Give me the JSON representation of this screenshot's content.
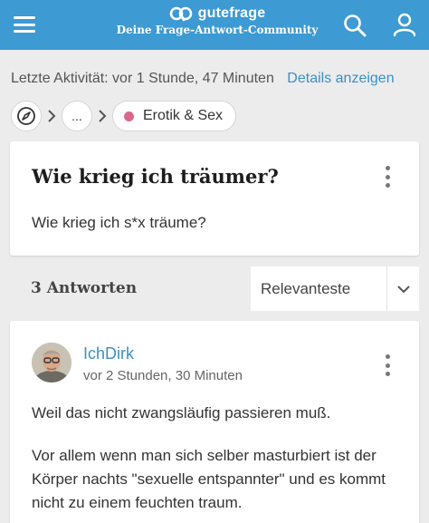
{
  "header": {
    "brand": "gutefrage",
    "tagline": "Deine Frage-Antwort-Community",
    "menu_icon": "hamburger-icon",
    "search_icon": "search-icon",
    "user_icon": "user-icon",
    "color": "#3d9ad3"
  },
  "activity": {
    "text": "Letzte Aktivität: vor 1 Stunde, 47 Minuten",
    "details_link": "Details anzeigen"
  },
  "breadcrumb": {
    "home_icon": "compass-icon",
    "ellipsis": "...",
    "category": "Erotik & Sex",
    "category_color": "#d9688a"
  },
  "question": {
    "title": "Wie krieg ich träumer?",
    "body": "Wie krieg ich s*x träume?"
  },
  "answers": {
    "count_label": "3 Antworten",
    "sort_value": "Relevanteste"
  },
  "answer": {
    "author": "IchDirk",
    "time": "vor 2 Stunden, 30 Minuten",
    "paragraph1": "Weil das nicht zwangsläufig passieren muß.",
    "paragraph2": "Vor allem wenn man sich selber masturbiert ist der Körper nachts \"sexuelle entspannter\" und es kommt nicht zu einem feuchten traum."
  }
}
